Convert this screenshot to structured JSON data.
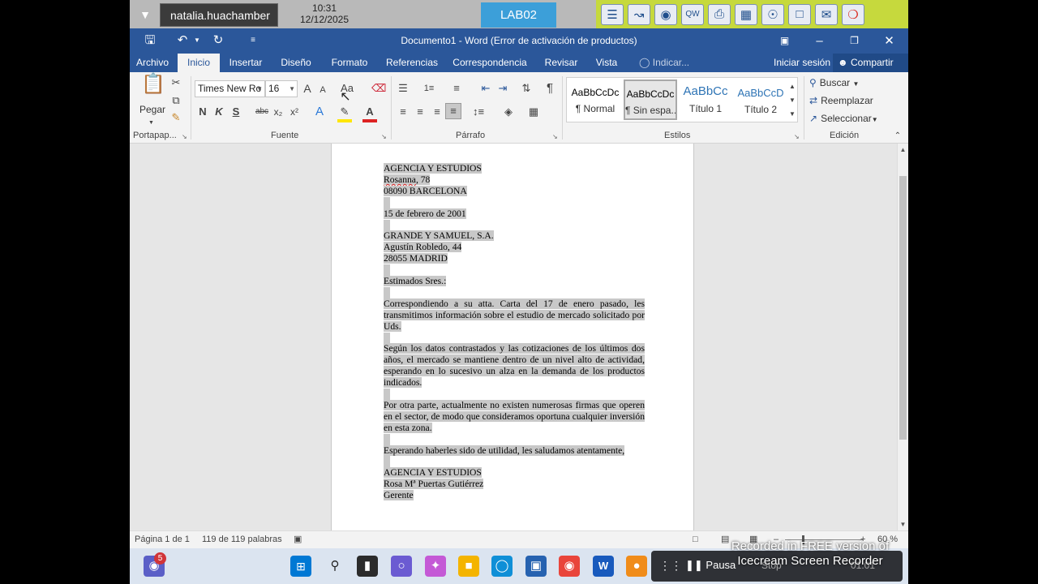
{
  "session_bar": {
    "user": "natalia.huachamber",
    "time": "10:31",
    "date": "12/12/2025",
    "lab": "LAB02",
    "app_icons": [
      "document-list-icon",
      "line-chart-icon",
      "disc-icon",
      "keyboard-icon",
      "printer-icon",
      "window-icon",
      "globe-icon",
      "book-icon",
      "chat-icon",
      "lifebuoy-icon"
    ]
  },
  "word": {
    "title": "Documento1 - Word (Error de activación de productos)",
    "tabs": [
      "Archivo",
      "Inicio",
      "Insertar",
      "Diseño",
      "Formato",
      "Referencias",
      "Correspondencia",
      "Revisar",
      "Vista"
    ],
    "active_tab": "Inicio",
    "tell_me": "Indicar...",
    "sign_in": "Iniciar sesión",
    "share": "Compartir"
  },
  "ribbon": {
    "clipboard": {
      "paste": "Pegar",
      "label": "Portapap..."
    },
    "font": {
      "family": "Times New Ro",
      "size": "16",
      "label": "Fuente",
      "bold": "N",
      "italic": "K",
      "underline": "S",
      "strike": "abc",
      "sub": "x₂",
      "sup": "x²",
      "grow": "A",
      "shrink": "A",
      "case": "Aa"
    },
    "paragraph": {
      "label": "Párrafo",
      "pilcrow": "¶"
    },
    "styles": {
      "label": "Estilos",
      "items": [
        {
          "sample": "AaBbCcDc",
          "name": "¶ Normal"
        },
        {
          "sample": "AaBbCcDc",
          "name": "¶ Sin espa..."
        },
        {
          "sample": "AaBbCc",
          "name": "Título 1"
        },
        {
          "sample": "AaBbCcD",
          "name": "Título 2"
        }
      ]
    },
    "editing": {
      "label": "Edición",
      "find": "Buscar",
      "replace": "Reemplazar",
      "select": "Seleccionar"
    }
  },
  "document": {
    "lines": {
      "l1": "AGENCIA Y ESTUDIOS",
      "l2a": "Rosanna",
      "l2b": ", 78",
      "l3": "08090 BARCELONA",
      "l4": "15 de febrero de 2001",
      "l5": "GRANDE Y SAMUEL, S.A.",
      "l6": "Agustín Robledo, 44",
      "l7": "28055 MADRID",
      "l8": "Estimados Sres.:",
      "p1": "Correspondiendo a su atta. Carta del 17 de enero pasado, les transmitimos información sobre el estudio de mercado solicitado por Uds.",
      "p2": "Según los datos contrastados y las cotizaciones de los últimos dos años, el mercado se mantiene dentro de un nivel alto de actividad, esperando en lo sucesivo un alza en la demanda de los productos indicados.",
      "p3": "Por otra parte, actualmente no existen numerosas firmas que operen en el sector, de modo que consideramos oportuna cualquier inversión en esta zona.",
      "p4": "Esperando haberles sido de utilidad, les saludamos atentamente,",
      "s1": "AGENCIA Y ESTUDIOS",
      "s2": "Rosa Mª Puertas Gutiérrez",
      "s3": "Gerente"
    }
  },
  "status": {
    "page": "Página 1 de 1",
    "words": "119 de 119 palabras",
    "zoom": "60 %"
  },
  "taskbar": {
    "badge": "5",
    "recorder_pause": "Pausa",
    "recorder_stop": "Stop",
    "recorder_time": "01:01",
    "watermark": "Recorded in FREE version of Icecream Screen Recorder"
  }
}
